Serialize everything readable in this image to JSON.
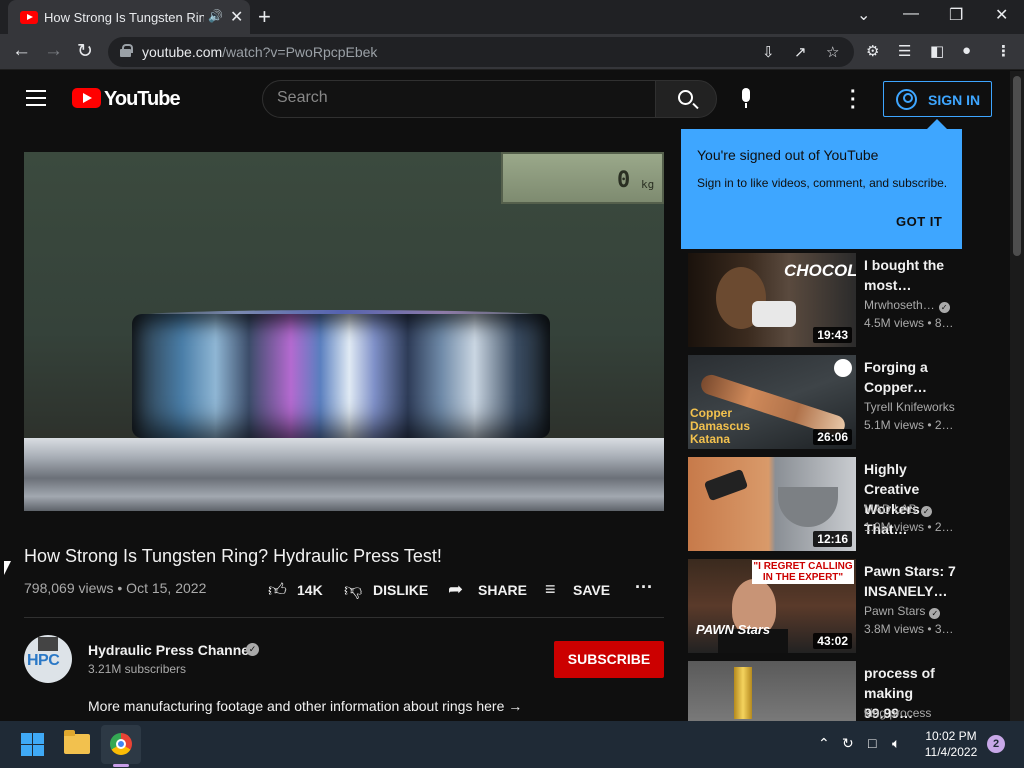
{
  "browser": {
    "tab_title": "How Strong Is Tungsten Ring? Hydraulic Press Test!",
    "url_host": "youtube.com",
    "url_path": "/watch?v=PwoRpcpEbek"
  },
  "youtube": {
    "logo_text": "YouTube",
    "search_placeholder": "Search",
    "signin_label": "SIGN IN"
  },
  "popup": {
    "title": "You're signed out of YouTube",
    "subtitle": "Sign in to like videos, comment, and subscribe.",
    "button": "GOT IT"
  },
  "player": {
    "lcd_value": "0",
    "lcd_unit": "kg"
  },
  "video": {
    "title": "How Strong Is Tungsten Ring? Hydraulic Press Test!",
    "meta": "798,069 views • Oct 15, 2022",
    "like_count": "14K",
    "dislike_label": "DISLIKE",
    "share_label": "SHARE",
    "save_label": "SAVE"
  },
  "channel": {
    "name": "Hydraulic Press Channel",
    "avatar_text": "HPC",
    "subscribers": "3.21M subscribers",
    "subscribe_label": "SUBSCRIBE",
    "description": "More manufacturing footage and other information about rings here →"
  },
  "recommendations": [
    {
      "title": "I bought the most...",
      "title_l1": "I bought the",
      "title_l2": "most…",
      "channel": "Mrwhoseth…",
      "verified": true,
      "views": "4.5M views • 8…",
      "duration": "19:43",
      "thumb_text": "CHOCOLATE"
    },
    {
      "title_l1": "Forging a",
      "title_l2": "Copper…",
      "channel": "Tyrell Knifeworks",
      "verified": false,
      "views": "5.1M views • 2…",
      "duration": "26:06",
      "thumb_text": "Copper Damascus Katana"
    },
    {
      "title_l1": "Highly Creative",
      "title_l2": "Workers That…",
      "channel": "MAD LAB",
      "verified": true,
      "views": "1.9M views • 2…",
      "duration": "12:16",
      "thumb_text": ""
    },
    {
      "title_l1": "Pawn Stars: 7",
      "title_l2": "INSANELY…",
      "channel": "Pawn Stars",
      "verified": true,
      "views": "3.8M views • 3…",
      "duration": "43:02",
      "thumb_text": "\"I REGRET CALLING IN THE EXPERT\"",
      "thumb_logo": "PAWN Stars"
    },
    {
      "title_l1": "process of",
      "title_l2": "making 99.99…",
      "channel": "king process",
      "verified": false,
      "views": "",
      "duration": "",
      "thumb_text": ""
    }
  ],
  "taskbar": {
    "time": "10:02 PM",
    "date": "11/4/2022",
    "notifications": "2"
  },
  "colors": {
    "youtube_red": "#ff0000",
    "accent_blue": "#3ea6ff",
    "subscribe_red": "#cc0000",
    "background": "#0f0f0f"
  }
}
